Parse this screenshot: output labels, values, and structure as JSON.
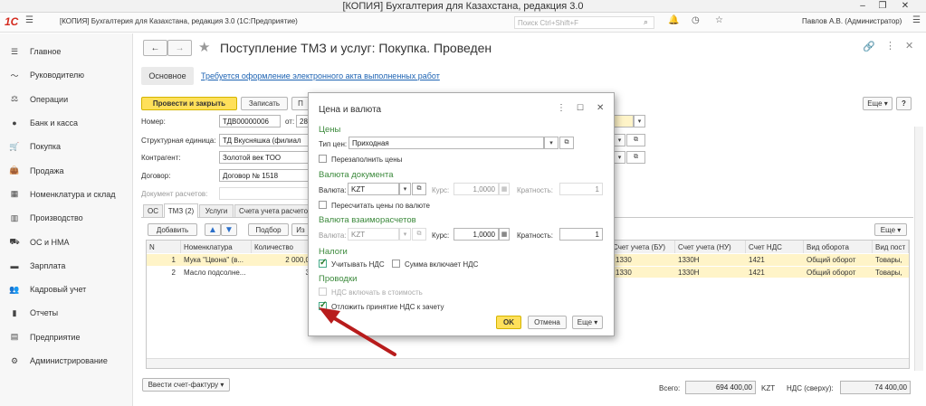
{
  "window": {
    "title": "[КОПИЯ] Бухгалтерия для Казахстана, редакция 3.0"
  },
  "appbar": {
    "title": "[КОПИЯ] Бухгалтерия для Казахстана, редакция 3.0 (1С:Предприятие)",
    "search_placeholder": "Поиск Ctrl+Shift+F",
    "user": "Павлов А.В. (Администратор)",
    "logo": "1С"
  },
  "sidebar": {
    "items": [
      {
        "label": "Главное",
        "icon": "menu-icon"
      },
      {
        "label": "Руководителю",
        "icon": "chart-line-icon"
      },
      {
        "label": "Операции",
        "icon": "operations-icon"
      },
      {
        "label": "Банк и касса",
        "icon": "bank-icon"
      },
      {
        "label": "Покупка",
        "icon": "cart-icon"
      },
      {
        "label": "Продажа",
        "icon": "bag-icon"
      },
      {
        "label": "Номенклатура и склад",
        "icon": "warehouse-icon"
      },
      {
        "label": "Производство",
        "icon": "factory-icon"
      },
      {
        "label": "ОС и НМА",
        "icon": "truck-icon"
      },
      {
        "label": "Зарплата",
        "icon": "salary-icon"
      },
      {
        "label": "Кадровый учет",
        "icon": "people-icon"
      },
      {
        "label": "Отчеты",
        "icon": "reports-icon"
      },
      {
        "label": "Предприятие",
        "icon": "building-icon"
      },
      {
        "label": "Администрирование",
        "icon": "gear-icon"
      }
    ]
  },
  "doc": {
    "title": "Поступление ТМЗ и услуг: Покупка. Проведен",
    "tab_main": "Основное",
    "link": "Требуется оформление электронного акта выполненных работ",
    "btn_post_close": "Провести и закрыть",
    "btn_save": "Записать",
    "btn_more": "Еще",
    "btn_help": "?",
    "fields": {
      "number_label": "Номер:",
      "number_value": "ТДВ00000006",
      "from_label": "от:",
      "date_value": "28.",
      "unit_label": "Структурная единица:",
      "unit_value": "ТД Вкусняшка (филиал",
      "contractor_label": "Контрагент:",
      "contractor_value": "Золотой век ТОО",
      "contract_label": "Договор:",
      "contract_value": "Договор № 1518",
      "settlement_label": "Документ расчетов:"
    },
    "tabs": [
      "ОС",
      "ТМЗ (2)",
      "Услуги",
      "Счета учета расчетов"
    ],
    "table_toolbar": {
      "add": "Добавить",
      "pick": "Подбор",
      "more_trunc": "Из",
      "more": "Еще"
    },
    "columns": [
      "N",
      "Номенклатура",
      "Количество",
      "Счет учета (БУ)",
      "Счет учета (НУ)",
      "Счет НДС",
      "Вид оборота",
      "Вид пост"
    ],
    "rows": [
      {
        "n": "1",
        "name": "Мука \"Цвона\" (в...",
        "qty": "2 000,0",
        "acc_bu": "1330",
        "acc_nu": "1330Н",
        "vat": "1421",
        "turnover": "Общий оборот",
        "kind": "Товары,"
      },
      {
        "n": "2",
        "name": "Масло подсолне...",
        "qty": "3",
        "acc_bu": "1330",
        "acc_nu": "1330Н",
        "vat": "1421",
        "turnover": "Общий оборот",
        "kind": "Товары,"
      }
    ],
    "footer": {
      "invoice_btn": "Ввести счет-фактуру",
      "total_label": "Всего:",
      "total_value": "694 400,00",
      "currency": "KZT",
      "vat_label": "НДС (сверху):",
      "vat_value": "74 400,00"
    }
  },
  "dialog": {
    "title": "Цена и валюта",
    "sec_prices": "Цены",
    "price_type_label": "Тип цен:",
    "price_type_value": "Приходная",
    "refill_prices": "Перезаполнить цены",
    "sec_doc_currency": "Валюта документа",
    "currency_label": "Валюта:",
    "currency_value": "KZT",
    "rate_label": "Курс:",
    "rate_value": "1,0000",
    "mult_label": "Кратность:",
    "mult_value": "1",
    "recalc_prices": "Пересчитать цены по валюте",
    "sec_settle_currency": "Валюта взаиморасчетов",
    "settle_currency_value": "KZT",
    "settle_rate_value": "1,0000",
    "settle_mult_value": "1",
    "sec_taxes": "Налоги",
    "consider_vat": "Учитывать НДС",
    "sum_incl_vat": "Сумма включает НДС",
    "sec_postings": "Проводки",
    "vat_in_cost": "НДС включать в стоимость",
    "defer_vat": "Отложить принятие НДС к зачету",
    "ok": "OK",
    "cancel": "Отмена",
    "more": "Еще",
    "checks": {
      "refill_prices": false,
      "recalc_prices": false,
      "consider_vat": true,
      "sum_incl_vat": false,
      "vat_in_cost": false,
      "defer_vat": true
    }
  },
  "colors": {
    "accent_yellow": "#ffe05a",
    "section_green": "#3c8a3c",
    "arrow_red": "#b81c1c",
    "row_selected": "#fff4c8",
    "logo_red": "#d42a1e"
  }
}
